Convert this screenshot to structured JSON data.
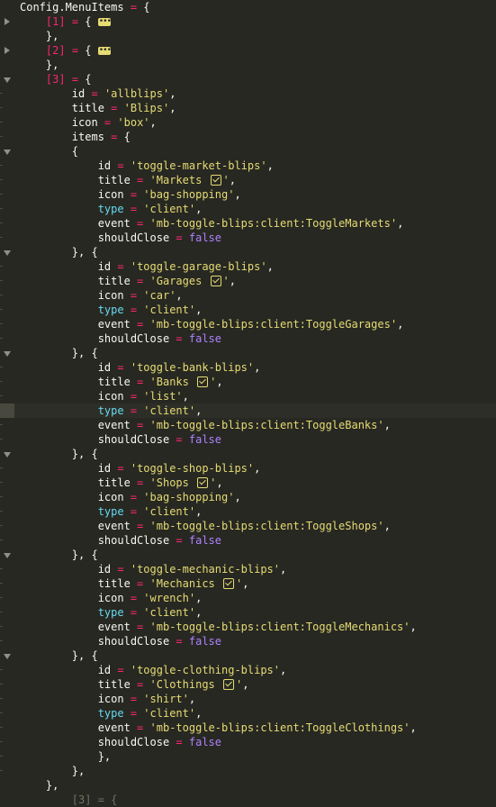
{
  "editor": {
    "lines": [
      {
        "indent": 0,
        "gutter": "",
        "parts": [
          {
            "t": "var",
            "s": "Config.MenuItems"
          },
          {
            "t": "op",
            "s": " = "
          },
          {
            "t": "var",
            "s": "{"
          }
        ]
      },
      {
        "indent": 1,
        "gutter": "fold-closed",
        "parts": [
          {
            "t": "op",
            "s": "[1]"
          },
          {
            "t": "op",
            "s": " = "
          },
          {
            "t": "var",
            "s": "{ "
          },
          {
            "t": "ellipsis",
            "s": ""
          }
        ]
      },
      {
        "indent": 1,
        "gutter": "",
        "parts": [
          {
            "t": "var",
            "s": "},"
          }
        ]
      },
      {
        "indent": 1,
        "gutter": "fold-closed",
        "parts": [
          {
            "t": "op",
            "s": "[2]"
          },
          {
            "t": "op",
            "s": " = "
          },
          {
            "t": "var",
            "s": "{ "
          },
          {
            "t": "ellipsis",
            "s": ""
          }
        ]
      },
      {
        "indent": 1,
        "gutter": "",
        "parts": [
          {
            "t": "var",
            "s": "},"
          }
        ]
      },
      {
        "indent": 1,
        "gutter": "fold-open",
        "parts": [
          {
            "t": "op",
            "s": "[3]"
          },
          {
            "t": "op",
            "s": " = "
          },
          {
            "t": "var",
            "s": "{"
          }
        ]
      },
      {
        "indent": 2,
        "gutter": "tick",
        "parts": [
          {
            "t": "var",
            "s": "id"
          },
          {
            "t": "op",
            "s": " = "
          },
          {
            "t": "str",
            "s": "'allblips'"
          },
          {
            "t": "var",
            "s": ","
          }
        ]
      },
      {
        "indent": 2,
        "gutter": "tick",
        "parts": [
          {
            "t": "var",
            "s": "title"
          },
          {
            "t": "op",
            "s": " = "
          },
          {
            "t": "str",
            "s": "'Blips'"
          },
          {
            "t": "var",
            "s": ","
          }
        ]
      },
      {
        "indent": 2,
        "gutter": "tick",
        "parts": [
          {
            "t": "var",
            "s": "icon"
          },
          {
            "t": "op",
            "s": " = "
          },
          {
            "t": "str",
            "s": "'box'"
          },
          {
            "t": "var",
            "s": ","
          }
        ]
      },
      {
        "indent": 2,
        "gutter": "tick",
        "parts": [
          {
            "t": "var",
            "s": "items"
          },
          {
            "t": "op",
            "s": " = "
          },
          {
            "t": "var",
            "s": "{"
          }
        ]
      },
      {
        "indent": 2,
        "gutter": "fold-open",
        "parts": [
          {
            "t": "var",
            "s": "{"
          }
        ]
      },
      {
        "indent": 3,
        "gutter": "tick",
        "parts": [
          {
            "t": "var",
            "s": "id"
          },
          {
            "t": "op",
            "s": " = "
          },
          {
            "t": "str",
            "s": "'toggle-market-blips'"
          },
          {
            "t": "var",
            "s": ","
          }
        ]
      },
      {
        "indent": 3,
        "gutter": "tick",
        "parts": [
          {
            "t": "var",
            "s": "title"
          },
          {
            "t": "op",
            "s": " = "
          },
          {
            "t": "str",
            "s": "'Markets "
          },
          {
            "t": "check",
            "s": ""
          },
          {
            "t": "str",
            "s": "'"
          },
          {
            "t": "var",
            "s": ","
          }
        ]
      },
      {
        "indent": 3,
        "gutter": "tick",
        "parts": [
          {
            "t": "var",
            "s": "icon"
          },
          {
            "t": "op",
            "s": " = "
          },
          {
            "t": "str",
            "s": "'bag-shopping'"
          },
          {
            "t": "var",
            "s": ","
          }
        ]
      },
      {
        "indent": 3,
        "gutter": "tick",
        "parts": [
          {
            "t": "type",
            "s": "type"
          },
          {
            "t": "op",
            "s": " = "
          },
          {
            "t": "str",
            "s": "'client'"
          },
          {
            "t": "var",
            "s": ","
          }
        ]
      },
      {
        "indent": 3,
        "gutter": "tick",
        "parts": [
          {
            "t": "var",
            "s": "event"
          },
          {
            "t": "op",
            "s": " = "
          },
          {
            "t": "str",
            "s": "'mb-toggle-blips:client:ToggleMarkets'"
          },
          {
            "t": "var",
            "s": ","
          }
        ]
      },
      {
        "indent": 3,
        "gutter": "tick",
        "parts": [
          {
            "t": "var",
            "s": "shouldClose"
          },
          {
            "t": "op",
            "s": " = "
          },
          {
            "t": "bool",
            "s": "false"
          }
        ]
      },
      {
        "indent": 2,
        "gutter": "fold-open",
        "parts": [
          {
            "t": "var",
            "s": "}, {"
          }
        ]
      },
      {
        "indent": 3,
        "gutter": "tick",
        "parts": [
          {
            "t": "var",
            "s": "id"
          },
          {
            "t": "op",
            "s": " = "
          },
          {
            "t": "str",
            "s": "'toggle-garage-blips'"
          },
          {
            "t": "var",
            "s": ","
          }
        ]
      },
      {
        "indent": 3,
        "gutter": "tick",
        "parts": [
          {
            "t": "var",
            "s": "title"
          },
          {
            "t": "op",
            "s": " = "
          },
          {
            "t": "str",
            "s": "'Garages "
          },
          {
            "t": "check",
            "s": ""
          },
          {
            "t": "str",
            "s": "'"
          },
          {
            "t": "var",
            "s": ","
          }
        ]
      },
      {
        "indent": 3,
        "gutter": "tick",
        "parts": [
          {
            "t": "var",
            "s": "icon"
          },
          {
            "t": "op",
            "s": " = "
          },
          {
            "t": "str",
            "s": "'car'"
          },
          {
            "t": "var",
            "s": ","
          }
        ]
      },
      {
        "indent": 3,
        "gutter": "tick",
        "parts": [
          {
            "t": "type",
            "s": "type"
          },
          {
            "t": "op",
            "s": " = "
          },
          {
            "t": "str",
            "s": "'client'"
          },
          {
            "t": "var",
            "s": ","
          }
        ]
      },
      {
        "indent": 3,
        "gutter": "tick",
        "parts": [
          {
            "t": "var",
            "s": "event"
          },
          {
            "t": "op",
            "s": " = "
          },
          {
            "t": "str",
            "s": "'mb-toggle-blips:client:ToggleGarages'"
          },
          {
            "t": "var",
            "s": ","
          }
        ]
      },
      {
        "indent": 3,
        "gutter": "tick",
        "parts": [
          {
            "t": "var",
            "s": "shouldClose"
          },
          {
            "t": "op",
            "s": " = "
          },
          {
            "t": "bool",
            "s": "false"
          }
        ]
      },
      {
        "indent": 2,
        "gutter": "fold-open",
        "parts": [
          {
            "t": "var",
            "s": "}, {"
          }
        ]
      },
      {
        "indent": 3,
        "gutter": "tick",
        "parts": [
          {
            "t": "var",
            "s": "id"
          },
          {
            "t": "op",
            "s": " = "
          },
          {
            "t": "str",
            "s": "'toggle-bank-blips'"
          },
          {
            "t": "var",
            "s": ","
          }
        ]
      },
      {
        "indent": 3,
        "gutter": "tick",
        "parts": [
          {
            "t": "var",
            "s": "title"
          },
          {
            "t": "op",
            "s": " = "
          },
          {
            "t": "str",
            "s": "'Banks "
          },
          {
            "t": "check",
            "s": ""
          },
          {
            "t": "str",
            "s": "'"
          },
          {
            "t": "var",
            "s": ","
          }
        ]
      },
      {
        "indent": 3,
        "gutter": "tick",
        "parts": [
          {
            "t": "var",
            "s": "icon"
          },
          {
            "t": "op",
            "s": " = "
          },
          {
            "t": "str",
            "s": "'list'"
          },
          {
            "t": "var",
            "s": ","
          }
        ]
      },
      {
        "indent": 3,
        "gutter": "mark",
        "parts": [
          {
            "t": "type",
            "s": "type"
          },
          {
            "t": "op",
            "s": " = "
          },
          {
            "t": "str",
            "s": "'client'"
          },
          {
            "t": "var",
            "s": ","
          }
        ]
      },
      {
        "indent": 3,
        "gutter": "tick",
        "parts": [
          {
            "t": "var",
            "s": "event"
          },
          {
            "t": "op",
            "s": " = "
          },
          {
            "t": "str",
            "s": "'mb-toggle-blips:client:ToggleBanks'"
          },
          {
            "t": "var",
            "s": ","
          }
        ]
      },
      {
        "indent": 3,
        "gutter": "tick",
        "parts": [
          {
            "t": "var",
            "s": "shouldClose"
          },
          {
            "t": "op",
            "s": " = "
          },
          {
            "t": "bool",
            "s": "false"
          }
        ]
      },
      {
        "indent": 2,
        "gutter": "fold-open",
        "parts": [
          {
            "t": "var",
            "s": "}, {"
          }
        ]
      },
      {
        "indent": 3,
        "gutter": "tick",
        "parts": [
          {
            "t": "var",
            "s": "id"
          },
          {
            "t": "op",
            "s": " = "
          },
          {
            "t": "str",
            "s": "'toggle-shop-blips'"
          },
          {
            "t": "var",
            "s": ","
          }
        ]
      },
      {
        "indent": 3,
        "gutter": "tick",
        "parts": [
          {
            "t": "var",
            "s": "title"
          },
          {
            "t": "op",
            "s": " = "
          },
          {
            "t": "str",
            "s": "'Shops "
          },
          {
            "t": "check",
            "s": ""
          },
          {
            "t": "str",
            "s": "'"
          },
          {
            "t": "var",
            "s": ","
          }
        ]
      },
      {
        "indent": 3,
        "gutter": "tick",
        "parts": [
          {
            "t": "var",
            "s": "icon"
          },
          {
            "t": "op",
            "s": " = "
          },
          {
            "t": "str",
            "s": "'bag-shopping'"
          },
          {
            "t": "var",
            "s": ","
          }
        ]
      },
      {
        "indent": 3,
        "gutter": "tick",
        "parts": [
          {
            "t": "type",
            "s": "type"
          },
          {
            "t": "op",
            "s": " = "
          },
          {
            "t": "str",
            "s": "'client'"
          },
          {
            "t": "var",
            "s": ","
          }
        ]
      },
      {
        "indent": 3,
        "gutter": "tick",
        "parts": [
          {
            "t": "var",
            "s": "event"
          },
          {
            "t": "op",
            "s": " = "
          },
          {
            "t": "str",
            "s": "'mb-toggle-blips:client:ToggleShops'"
          },
          {
            "t": "var",
            "s": ","
          }
        ]
      },
      {
        "indent": 3,
        "gutter": "tick",
        "parts": [
          {
            "t": "var",
            "s": "shouldClose"
          },
          {
            "t": "op",
            "s": " = "
          },
          {
            "t": "bool",
            "s": "false"
          }
        ]
      },
      {
        "indent": 2,
        "gutter": "fold-open",
        "parts": [
          {
            "t": "var",
            "s": "}, {"
          }
        ]
      },
      {
        "indent": 3,
        "gutter": "tick",
        "parts": [
          {
            "t": "var",
            "s": "id"
          },
          {
            "t": "op",
            "s": " = "
          },
          {
            "t": "str",
            "s": "'toggle-mechanic-blips'"
          },
          {
            "t": "var",
            "s": ","
          }
        ]
      },
      {
        "indent": 3,
        "gutter": "tick",
        "parts": [
          {
            "t": "var",
            "s": "title"
          },
          {
            "t": "op",
            "s": " = "
          },
          {
            "t": "str",
            "s": "'Mechanics "
          },
          {
            "t": "check",
            "s": ""
          },
          {
            "t": "str",
            "s": "'"
          },
          {
            "t": "var",
            "s": ","
          }
        ]
      },
      {
        "indent": 3,
        "gutter": "tick",
        "parts": [
          {
            "t": "var",
            "s": "icon"
          },
          {
            "t": "op",
            "s": " = "
          },
          {
            "t": "str",
            "s": "'wrench'"
          },
          {
            "t": "var",
            "s": ","
          }
        ]
      },
      {
        "indent": 3,
        "gutter": "tick",
        "parts": [
          {
            "t": "type",
            "s": "type"
          },
          {
            "t": "op",
            "s": " = "
          },
          {
            "t": "str",
            "s": "'client'"
          },
          {
            "t": "var",
            "s": ","
          }
        ]
      },
      {
        "indent": 3,
        "gutter": "tick",
        "parts": [
          {
            "t": "var",
            "s": "event"
          },
          {
            "t": "op",
            "s": " = "
          },
          {
            "t": "str",
            "s": "'mb-toggle-blips:client:ToggleMechanics'"
          },
          {
            "t": "var",
            "s": ","
          }
        ]
      },
      {
        "indent": 3,
        "gutter": "tick",
        "parts": [
          {
            "t": "var",
            "s": "shouldClose"
          },
          {
            "t": "op",
            "s": " = "
          },
          {
            "t": "bool",
            "s": "false"
          }
        ]
      },
      {
        "indent": 2,
        "gutter": "fold-open",
        "parts": [
          {
            "t": "var",
            "s": "}, {"
          }
        ]
      },
      {
        "indent": 3,
        "gutter": "tick",
        "parts": [
          {
            "t": "var",
            "s": "id"
          },
          {
            "t": "op",
            "s": " = "
          },
          {
            "t": "str",
            "s": "'toggle-clothing-blips'"
          },
          {
            "t": "var",
            "s": ","
          }
        ]
      },
      {
        "indent": 3,
        "gutter": "tick",
        "parts": [
          {
            "t": "var",
            "s": "title"
          },
          {
            "t": "op",
            "s": " = "
          },
          {
            "t": "str",
            "s": "'Clothings "
          },
          {
            "t": "check",
            "s": ""
          },
          {
            "t": "str",
            "s": "'"
          },
          {
            "t": "var",
            "s": ","
          }
        ]
      },
      {
        "indent": 3,
        "gutter": "tick",
        "parts": [
          {
            "t": "var",
            "s": "icon"
          },
          {
            "t": "op",
            "s": " = "
          },
          {
            "t": "str",
            "s": "'shirt'"
          },
          {
            "t": "var",
            "s": ","
          }
        ]
      },
      {
        "indent": 3,
        "gutter": "tick",
        "parts": [
          {
            "t": "type",
            "s": "type"
          },
          {
            "t": "op",
            "s": " = "
          },
          {
            "t": "str",
            "s": "'client'"
          },
          {
            "t": "var",
            "s": ","
          }
        ]
      },
      {
        "indent": 3,
        "gutter": "tick",
        "parts": [
          {
            "t": "var",
            "s": "event"
          },
          {
            "t": "op",
            "s": " = "
          },
          {
            "t": "str",
            "s": "'mb-toggle-blips:client:ToggleClothings'"
          },
          {
            "t": "var",
            "s": ","
          }
        ]
      },
      {
        "indent": 3,
        "gutter": "tick",
        "parts": [
          {
            "t": "var",
            "s": "shouldClose"
          },
          {
            "t": "op",
            "s": " = "
          },
          {
            "t": "bool",
            "s": "false"
          }
        ]
      },
      {
        "indent": 3,
        "gutter": "tick",
        "parts": [
          {
            "t": "var",
            "s": "},"
          }
        ]
      },
      {
        "indent": 2,
        "gutter": "tick",
        "parts": [
          {
            "t": "var",
            "s": "},"
          }
        ]
      },
      {
        "indent": 1,
        "gutter": "",
        "parts": [
          {
            "t": "var",
            "s": "},"
          }
        ]
      },
      {
        "indent": 2,
        "gutter": "",
        "parts": [
          {
            "t": "dim",
            "s": "[3] = {"
          }
        ]
      }
    ]
  },
  "colors": {
    "background": "#272822",
    "text": "#f8f8f2",
    "operator": "#f92672",
    "string": "#e6db74",
    "keyword_type": "#66d9ef",
    "boolean": "#ae81ff"
  },
  "icons": {
    "fold_closed": "triangle-right-icon",
    "fold_open": "triangle-down-icon",
    "folded_placeholder": "ellipsis-icon",
    "emoji": "check-box-icon"
  }
}
